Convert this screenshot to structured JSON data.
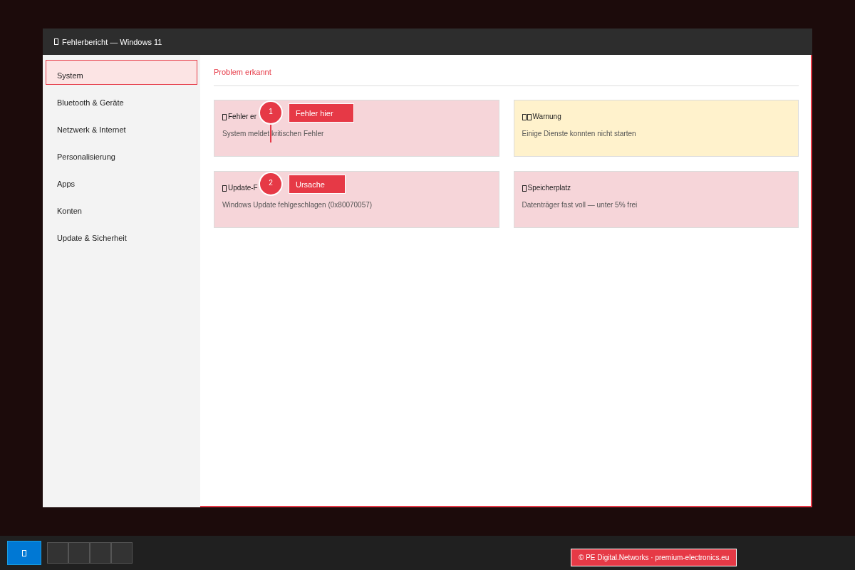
{
  "window": {
    "title": "Fehlerbericht — Windows 11"
  },
  "sidebar": {
    "items": [
      {
        "label": "System",
        "selected": true
      },
      {
        "label": "Bluetooth & Geräte",
        "selected": false
      },
      {
        "label": "Netzwerk & Internet",
        "selected": false
      },
      {
        "label": "Personalisierung",
        "selected": false
      },
      {
        "label": "Apps",
        "selected": false
      },
      {
        "label": "Konten",
        "selected": false
      },
      {
        "label": "Update & Sicherheit",
        "selected": false
      }
    ]
  },
  "main": {
    "heading": "Problem erkannt",
    "cards": [
      {
        "kind": "error",
        "title": "Fehler er",
        "text": "System meldet kritischen Fehler",
        "marker": {
          "number": "1",
          "label": "Fehler hier",
          "leader": true
        }
      },
      {
        "kind": "warning",
        "title": "Warnung",
        "text": "Einige Dienste konnten nicht starten"
      },
      {
        "kind": "error",
        "title": "Update-F",
        "text": "Windows Update fehlgeschlagen (0x80070057)",
        "marker": {
          "number": "2",
          "label": "Ursache",
          "leader": false
        }
      },
      {
        "kind": "error",
        "title": "Speicherplatz",
        "text": "Datenträger fast voll — unter 5% frei"
      }
    ]
  },
  "taskbar": {
    "apps": [
      {
        "kind": "app"
      },
      {
        "kind": "app"
      },
      {
        "kind": "app"
      },
      {
        "kind": "app"
      }
    ],
    "copyright": "© PE Digital.Networks · premium-electronics.eu"
  }
}
